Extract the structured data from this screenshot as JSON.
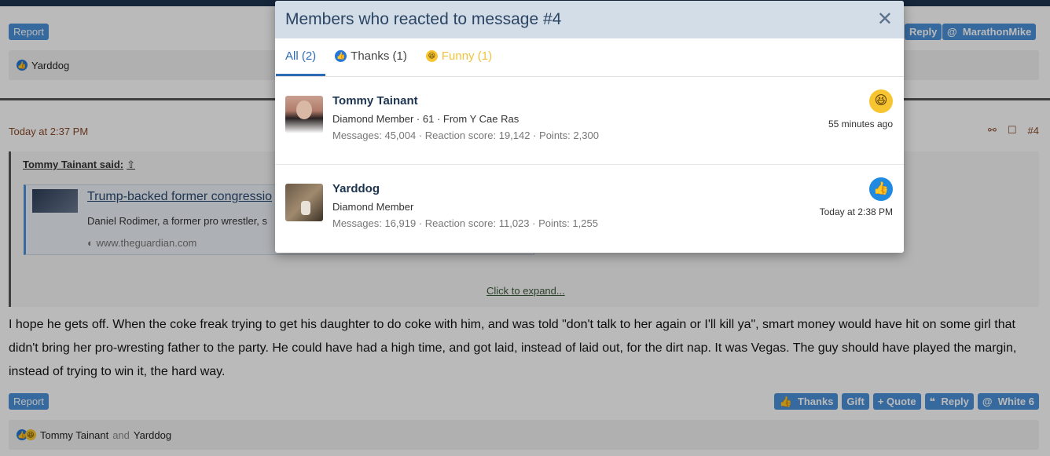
{
  "modal": {
    "title": "Members who reacted to message #4",
    "close_icon": "close-icon",
    "tabs": [
      {
        "label": "All (2)",
        "active": true
      },
      {
        "label": "Thanks (1)",
        "icon": "like-icon"
      },
      {
        "label": "Funny (1)",
        "icon": "laugh-icon"
      }
    ],
    "members": [
      {
        "name": "Tommy Tainant",
        "title": "Diamond Member · 61 · From Y Cae Ras",
        "stats": "Messages: 45,004 · Reaction score: 19,142 · Points: 2,300",
        "reaction": "laugh-icon",
        "time": "55 minutes ago"
      },
      {
        "name": "Yarddog",
        "title": "Diamond Member",
        "stats": "Messages: 16,919 · Reaction score: 11,023 · Points: 1,255",
        "reaction": "like-icon",
        "time": "Today at 2:38 PM"
      }
    ]
  },
  "prev_post": {
    "report_label": "Report",
    "reply_label": "Reply",
    "mention_label": "MarathonMike",
    "reaction_users": "Yarddog"
  },
  "post": {
    "date": "Today at 2:37 PM",
    "number": "#4",
    "quote_author": "Tommy Tainant said:",
    "embed_title": "Trump-backed former congressio",
    "embed_desc": "Daniel Rodimer, a former pro wrestler, s",
    "embed_site": "www.theguardian.com",
    "expand_label": "Click to expand...",
    "body": "I hope he gets off. When the coke freak trying to get his daughter to do coke with him, and was told \"don't talk to her again or I'll kill ya\", smart money would have hit on some girl that didn't bring her pro-wresting father to the party. He could have had a high time, and got laid, instead of laid out, for the dirt nap. It was Vegas. The guy should have played the margin, instead of trying to win it, the hard way.",
    "report_label": "Report",
    "actions": {
      "thanks": "Thanks",
      "gift": "Gift",
      "quote": "+ Quote",
      "reply": "Reply",
      "mention": "White 6"
    },
    "reaction_user_1": "Tommy Tainant",
    "reaction_and": "and",
    "reaction_user_2": "Yarddog"
  },
  "colors": {
    "accent": "#2d6cb5",
    "header_bg": "#d3dde8",
    "button_blue": "#4a90d9",
    "funny_yellow": "#f0c23a"
  }
}
